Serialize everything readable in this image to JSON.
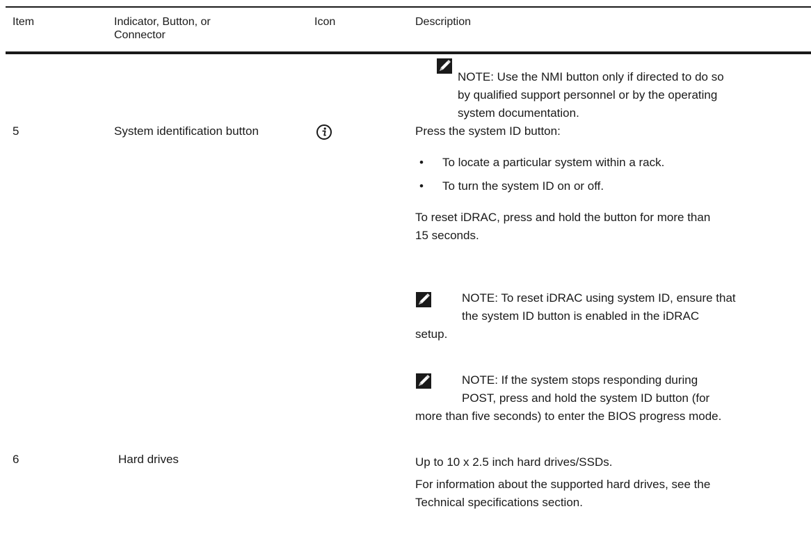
{
  "table": {
    "headers": {
      "item": "Item",
      "indicator_line1": "Indicator, Button, or",
      "indicator_line2": "Connector",
      "icon": "Icon",
      "description": "Description"
    },
    "nmi_note": {
      "line1": "NOTE: Use the NMI button only if directed to do so",
      "line2": "by qualified support personnel or by the operating",
      "line3": "system documentation."
    },
    "row5": {
      "item": "5",
      "name": "System identification button",
      "icon_name": "system-id-info-icon",
      "intro": "Press the system ID button:",
      "bullets": [
        "To locate a particular system within a rack.",
        "To turn the system ID on or off."
      ],
      "reset_line1": "To reset iDRAC, press and hold the button for more than",
      "reset_line2": "15 seconds.",
      "note1": {
        "line1": "NOTE: To reset iDRAC using system ID, ensure that",
        "line2": "the system ID button is enabled in the iDRAC",
        "line3": "setup."
      },
      "note2": {
        "line1": "NOTE: If the system stops responding during",
        "line2": "POST, press and hold the system ID button (for",
        "line3": "more than five seconds) to enter the BIOS progress mode."
      }
    },
    "row6": {
      "item": "6",
      "name": "Hard drives",
      "desc_line1": "Up to 10 x 2.5 inch hard drives/SSDs.",
      "desc_line2": "For information about the supported hard drives, see the",
      "desc_line3": "Technical specifications section."
    }
  }
}
